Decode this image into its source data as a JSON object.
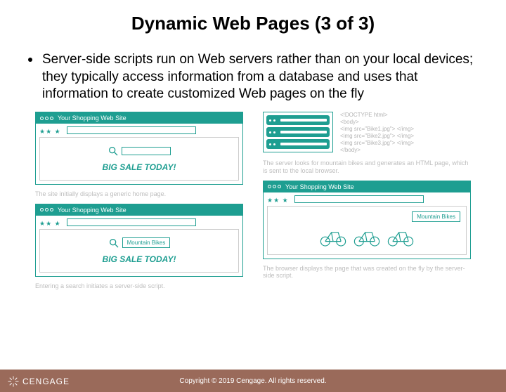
{
  "title": "Dynamic Web Pages (3 of 3)",
  "bullet": "Server-side scripts run on Web servers rather than on your local devices; they typically access information from a database and uses that information to create customized Web pages on the fly",
  "browser_title": "Your Shopping Web Site",
  "sale_text": "BIG SALE TODAY!",
  "search_value": "Mountain Bikes",
  "result_label": "Mountain Bikes",
  "captions": {
    "a": "The site initially displays a generic home page.",
    "b": "Entering a search initiates a server-side script.",
    "c": "The server looks for mountain bikes and generates an HTML page, which is sent to the local browser.",
    "d": "The browser displays the page that was created on the fly by the server-side script."
  },
  "code_lines": [
    "<!DOCTYPE html>",
    "<body>",
    "<img src=\"Bike1.jpg\"> </img>",
    "<img src=\"Bike2.jpg\"> </img>",
    "<img src=\"Bike3.jpg\"> </img>",
    "</body>"
  ],
  "footer": {
    "brand": "CENGAGE",
    "copyright": "Copyright © 2019 Cengage. All rights reserved."
  }
}
